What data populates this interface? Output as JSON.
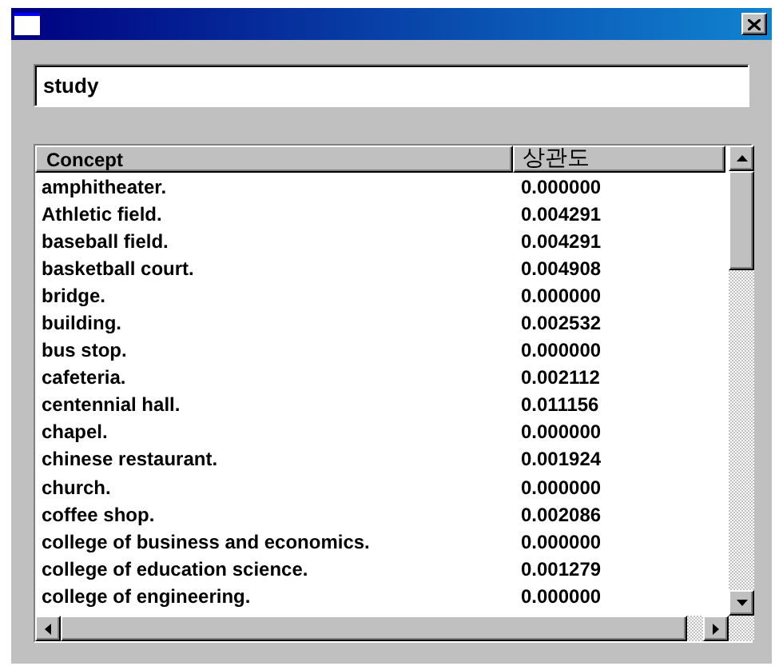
{
  "search": {
    "value": "study"
  },
  "table": {
    "columns": [
      "Concept",
      "상관도"
    ],
    "rows": [
      [
        "amphitheater.",
        "0.000000"
      ],
      [
        "Athletic field.",
        "0.004291"
      ],
      [
        "baseball field.",
        "0.004291"
      ],
      [
        "basketball court.",
        "0.004908"
      ],
      [
        "bridge.",
        "0.000000"
      ],
      [
        "building.",
        "0.002532"
      ],
      [
        "bus stop.",
        "0.000000"
      ],
      [
        "cafeteria.",
        "0.002112"
      ],
      [
        "centennial hall.",
        "0.011156"
      ],
      [
        "chapel.",
        "0.000000"
      ],
      [
        "chinese restaurant.",
        "0.001924"
      ],
      [
        "church.",
        "0.000000"
      ],
      [
        "coffee shop.",
        "0.002086"
      ],
      [
        "college of business and economics.",
        "0.000000"
      ],
      [
        "college of education science.",
        "0.001279"
      ],
      [
        "college of engineering.",
        "0.000000"
      ]
    ]
  }
}
